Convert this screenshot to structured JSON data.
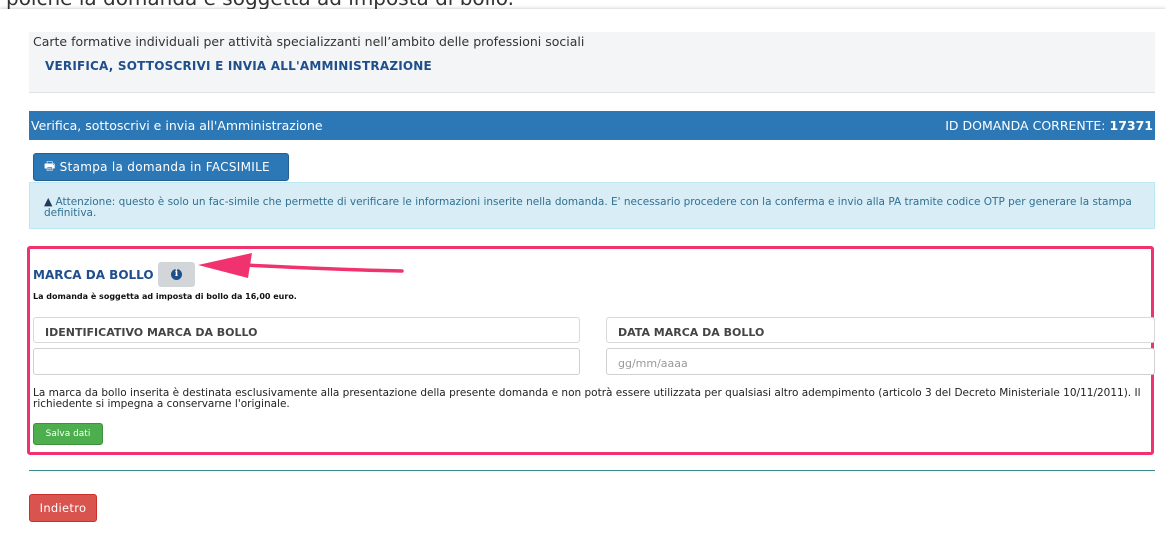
{
  "caption_text": "poiché la domanda è soggetta ad imposta di bollo.",
  "header": {
    "subtitle": "Carte formative individuali per attività specializzanti nell’ambito delle professioni sociali",
    "title": "VERIFICA, SOTTOSCRIVI E INVIA ALL'AMMINISTRAZIONE"
  },
  "panel": {
    "title": "Verifica, sottoscrivi e invia all'Amministrazione",
    "id_label": "ID DOMANDA CORRENTE:",
    "id_value": "17371"
  },
  "print_button": {
    "icon": "print-icon",
    "label": "Stampa la domanda in FACSIMILE"
  },
  "alert": {
    "icon": "warning-icon",
    "text": "Attenzione: questo è solo un fac-simile che permette di verificare le informazioni inserite nella domanda. E' necessario procedere con la conferma e invio alla PA tramite codice OTP per generare la stampa definitiva."
  },
  "bollo": {
    "title": "MARCA DA BOLLO",
    "info_icon": "info-icon",
    "note": "La domanda è soggetta ad imposta di bollo da 16,00 euro.",
    "id_label": "IDENTIFICATIVO MARCA DA BOLLO",
    "id_value": "",
    "date_label": "DATA MARCA DA BOLLO",
    "date_placeholder": "gg/mm/aaaa",
    "disclaimer": "La marca da bollo inserita è destinata esclusivamente alla presentazione della presente domanda e non potrà essere utilizzata per qualsiasi altro adempimento (articolo 3 del Decreto Ministeriale 10/11/2011). Il richiedente si impegna a conservarne l'originale.",
    "save_label": "Salva dati"
  },
  "back_label": "Indietro",
  "colors": {
    "primary": "#2c77b6",
    "highlight": "#f0336e",
    "success": "#4cae4c",
    "danger": "#d9534f",
    "alert_bg": "#d9edf7"
  }
}
